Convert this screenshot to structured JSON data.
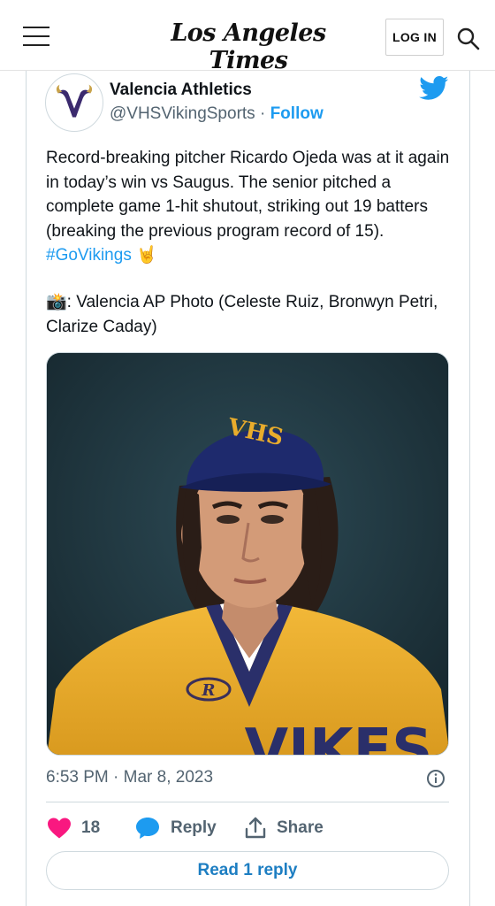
{
  "header": {
    "logo_text": "Los Angeles Times",
    "login_label": "LOG IN"
  },
  "tweet": {
    "author_name": "Valencia Athletics",
    "handle": "@VHSVikingSports",
    "separator": " · ",
    "follow_label": "Follow",
    "text": "Record-breaking pitcher Ricardo Ojeda was at it again in today’s win vs Saugus. The senior pitched a complete game 1-hit shutout, striking out 19 batters (breaking the previous program record of 15). ",
    "hashtag": "#GoVikings",
    "hashtag_emoji": "🤘",
    "credit_emoji": "📸",
    "credit_text": ": Valencia AP Photo (Celeste Ruiz, Bronwyn Petri, Clarize Caday)",
    "photo": {
      "cap_letters": "VHS",
      "jersey_letters": "VIKES",
      "logo_letter": "R"
    },
    "timestamp": "6:53 PM · Mar 8, 2023",
    "like_count": "18",
    "reply_label": "Reply",
    "share_label": "Share",
    "read_reply_label": "Read 1 reply"
  },
  "colors": {
    "twitter_blue": "#1d9bf0",
    "like_pink": "#f91880",
    "muted_gray": "#536471",
    "jersey_gold": "#e9ac2c",
    "cap_navy": "#1e2a6d",
    "photo_backdrop": "#1f3a44"
  },
  "icons": [
    "menu-icon",
    "search-icon",
    "twitter-bird-icon",
    "viking-logo-icon",
    "info-icon",
    "heart-icon",
    "reply-bubble-icon",
    "share-icon"
  ]
}
